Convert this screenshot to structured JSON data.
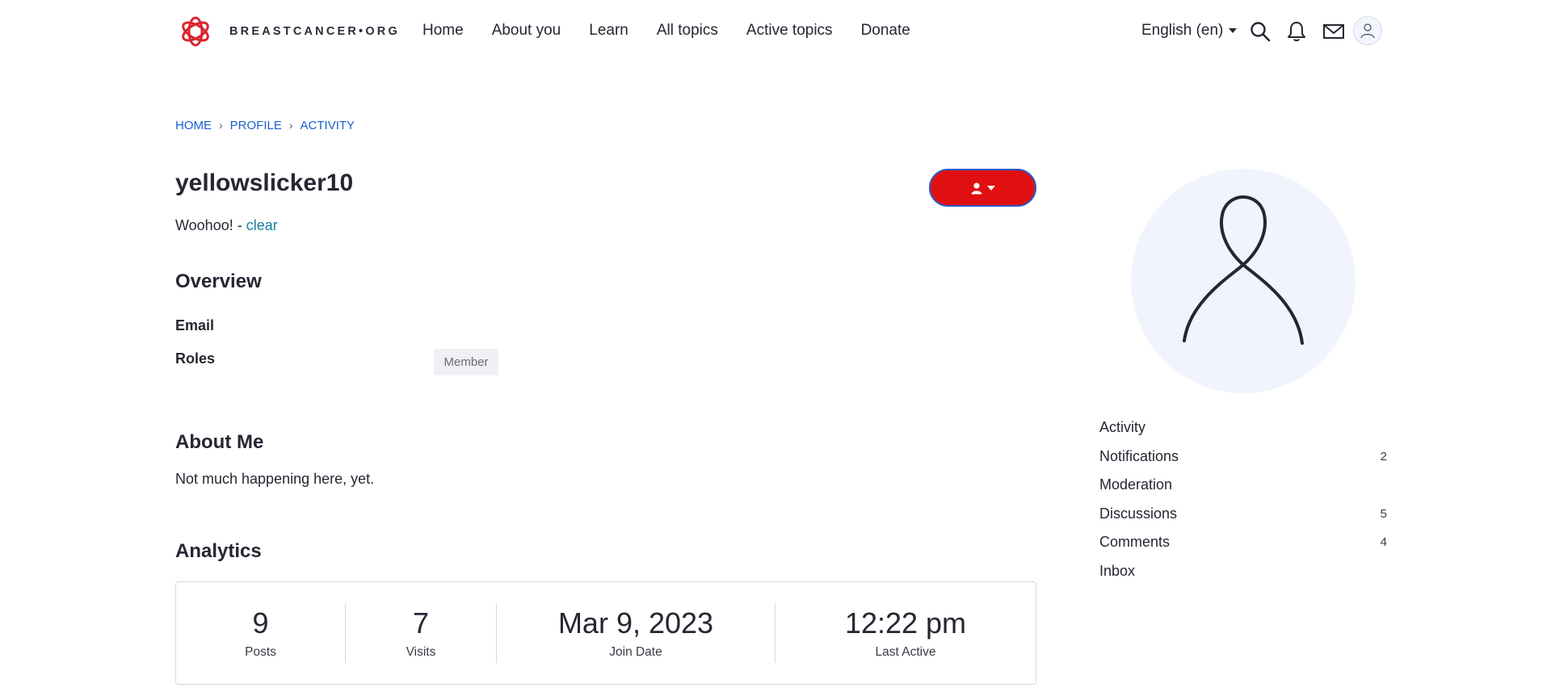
{
  "header": {
    "logo_text": "BREASTCANCER•ORG",
    "nav": [
      "Home",
      "About you",
      "Learn",
      "All topics",
      "Active topics",
      "Donate"
    ],
    "language": "English (en)",
    "icons": [
      "search-icon",
      "bell-icon",
      "mail-icon",
      "user-icon"
    ]
  },
  "breadcrumb": [
    "HOME",
    "PROFILE",
    "ACTIVITY"
  ],
  "profile": {
    "username": "yellowslicker10",
    "status_text": "Woohoo! - ",
    "status_clear": "clear",
    "user_menu_icon": "user-icon"
  },
  "overview": {
    "title": "Overview",
    "email_label": "Email",
    "roles_label": "Roles",
    "role": "Member"
  },
  "about": {
    "title": "About Me",
    "text": "Not much happening here, yet."
  },
  "analytics": {
    "title": "Analytics",
    "stats": [
      {
        "value": "9",
        "label": "Posts"
      },
      {
        "value": "7",
        "label": "Visits"
      },
      {
        "value": "Mar 9, 2023",
        "label": "Join Date"
      },
      {
        "value": "12:22 pm",
        "label": "Last Active"
      }
    ]
  },
  "sidebar": {
    "items": [
      {
        "label": "Activity",
        "count": ""
      },
      {
        "label": "Notifications",
        "count": "2"
      },
      {
        "label": "Moderation",
        "count": ""
      },
      {
        "label": "Discussions",
        "count": "5"
      },
      {
        "label": "Comments",
        "count": "4"
      },
      {
        "label": "Inbox",
        "count": ""
      }
    ]
  },
  "colors": {
    "brand_red": "#e01010",
    "link_blue": "#1a5fcf",
    "link_teal": "#177ea3",
    "text": "#262633"
  }
}
